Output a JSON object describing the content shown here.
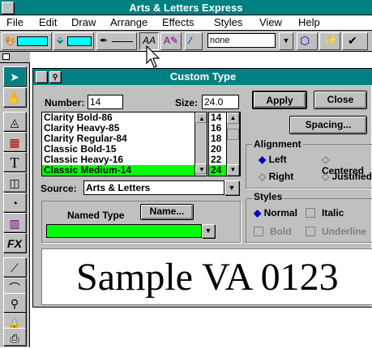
{
  "app": {
    "title": "Arts & Letters Express"
  },
  "menu": [
    "File",
    "Edit",
    "Draw",
    "Arrange",
    "Effects",
    "Styles",
    "View",
    "Help"
  ],
  "toolbar": {
    "style_value": "none"
  },
  "dialog": {
    "title": "Custom Type",
    "number_label": "Number:",
    "number_value": "14",
    "size_label": "Size:",
    "size_value": "24.0",
    "fonts": [
      "Clarity Bold-86",
      "Clarity Heavy-85",
      "Clarity Regular-84",
      "Classic Bold-15",
      "Classic Heavy-16",
      "Classic Medium-14"
    ],
    "selected_font": "Classic Medium-14",
    "sizes": [
      "14",
      "16",
      "18",
      "20",
      "22",
      "24"
    ],
    "selected_size": "24",
    "apply": "Apply",
    "close": "Close",
    "spacing": "Spacing...",
    "source_label": "Source:",
    "source_value": "Arts & Letters",
    "named_type_label": "Named Type",
    "name_button": "Name...",
    "alignment": {
      "title": "Alignment",
      "left": "Left",
      "center": "Centered",
      "right": "Right",
      "justified": "Justified"
    },
    "styles": {
      "title": "Styles",
      "normal": "Normal",
      "italic": "Italic",
      "bold": "Bold",
      "underline": "Underline"
    },
    "preview_text": "Sample VA 0123",
    "accent": "#00ff00",
    "title_color": "#008080"
  }
}
